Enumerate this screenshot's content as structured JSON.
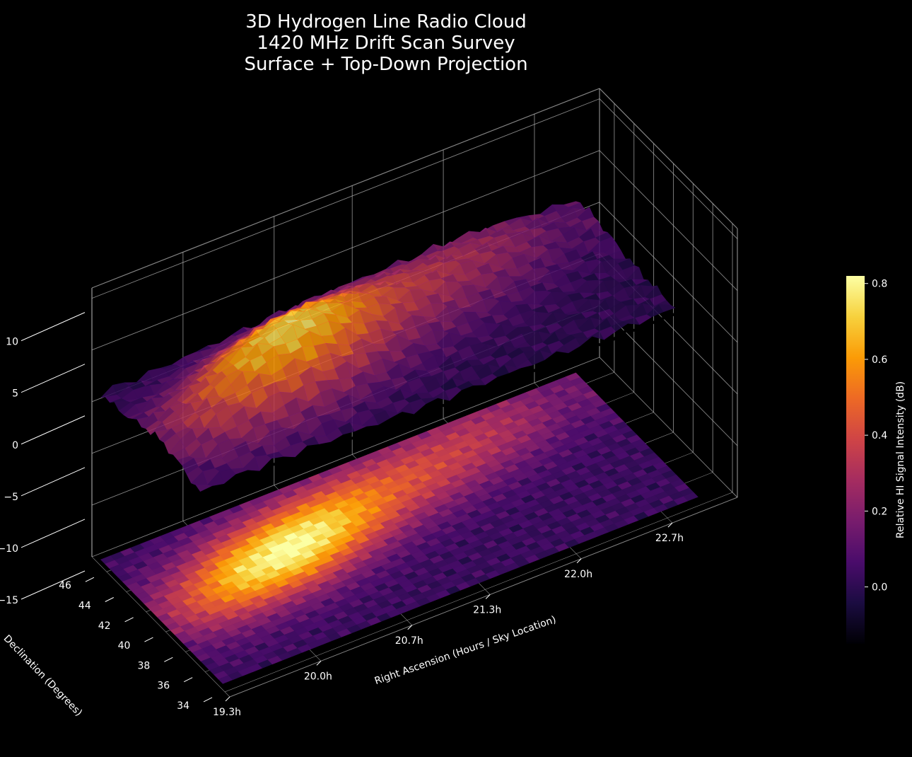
{
  "title_lines": [
    "3D Hydrogen Line Radio Cloud",
    "1420 MHz Drift Scan Survey",
    "Surface + Top-Down Projection"
  ],
  "chart_data": {
    "type": "surface",
    "title": "3D Hydrogen Line Radio Cloud\n1420 MHz Drift Scan Survey\nSurface + Top-Down Projection",
    "xlabel": "Right Ascension (Hours / Sky Location)",
    "ylabel": "Declination (Degrees)",
    "zlabel": "",
    "x_ticks": [
      "19.3h",
      "20.0h",
      "20.7h",
      "21.3h",
      "22.0h",
      "22.7h"
    ],
    "y_ticks": [
      "34",
      "36",
      "38",
      "40",
      "42",
      "44",
      "46"
    ],
    "z_ticks": [
      "−15",
      "−10",
      "−5",
      "0",
      "5",
      "10"
    ],
    "xlim": [
      19.3,
      23.2
    ],
    "ylim": [
      33.5,
      47.5
    ],
    "zlim": [
      -15,
      11
    ],
    "grid": true,
    "colormap": "inferno",
    "colorbar": {
      "label": "Relative HI Signal Intensity (dB)",
      "ticks": [
        "0.0",
        "0.2",
        "0.4",
        "0.6",
        "0.8"
      ],
      "range": [
        -0.15,
        0.82
      ]
    },
    "ridge": [
      {
        "ra": 19.3,
        "dec": 40.5,
        "intensity": 0.18
      },
      {
        "ra": 19.7,
        "dec": 41.0,
        "intensity": 0.45
      },
      {
        "ra": 20.0,
        "dec": 41.5,
        "intensity": 0.66
      },
      {
        "ra": 20.4,
        "dec": 42.0,
        "intensity": 0.78
      },
      {
        "ra": 20.7,
        "dec": 42.5,
        "intensity": 0.7
      },
      {
        "ra": 21.0,
        "dec": 43.0,
        "intensity": 0.55
      },
      {
        "ra": 21.3,
        "dec": 43.5,
        "intensity": 0.42
      },
      {
        "ra": 21.7,
        "dec": 44.0,
        "intensity": 0.34
      },
      {
        "ra": 22.0,
        "dec": 44.5,
        "intensity": 0.3
      },
      {
        "ra": 22.4,
        "dec": 45.0,
        "intensity": 0.22
      },
      {
        "ra": 22.7,
        "dec": 45.5,
        "intensity": 0.12
      }
    ]
  },
  "colors": {
    "background": "#000000",
    "grid": "#b0b0b0",
    "text": "#ffffff",
    "colormap_stops": [
      "#000004",
      "#1b0c41",
      "#4a0c6b",
      "#781c6d",
      "#a52c60",
      "#cf4446",
      "#ed6925",
      "#fb9b06",
      "#f7d13d",
      "#fcffa4"
    ]
  }
}
